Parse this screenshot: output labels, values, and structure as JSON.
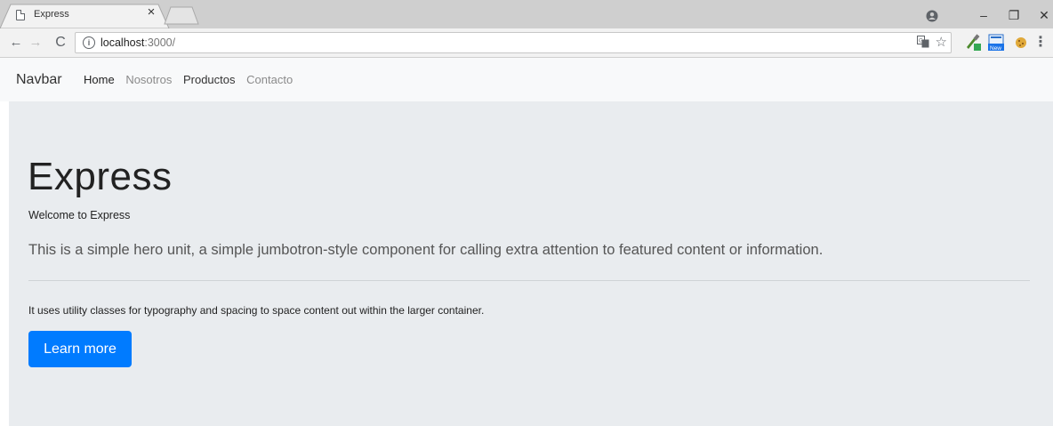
{
  "browser": {
    "tab_title": "Express",
    "tab_close": "×",
    "url_host": "localhost",
    "url_rest": ":3000/",
    "back_glyph": "←",
    "forward_glyph": "→",
    "reload_glyph": "C",
    "star_glyph": "☆",
    "menu_glyph": "⋮",
    "min_glyph": "–",
    "restore_glyph": "❐",
    "close_glyph": "✕",
    "ext_new_label": "New",
    "icons": [
      "page-icon",
      "info-icon",
      "translate-icon",
      "star-icon",
      "extension-icon",
      "cookie-icon",
      "account-icon"
    ]
  },
  "navbar": {
    "brand": "Navbar",
    "links": [
      {
        "label": "Home"
      },
      {
        "label": "Nosotros"
      },
      {
        "label": "Productos"
      },
      {
        "label": "Contacto"
      }
    ]
  },
  "jumbotron": {
    "title": "Express",
    "subtitle": "Welcome to Express",
    "lead": "This is a simple hero unit, a simple jumbotron-style component for calling extra attention to featured content or information.",
    "body": "It uses utility classes for typography and spacing to space content out within the larger container.",
    "button_label": "Learn more"
  },
  "colors": {
    "primary": "#007bff",
    "jumbotron_bg": "#e9ecef",
    "navbar_bg": "#f8f9fa"
  }
}
